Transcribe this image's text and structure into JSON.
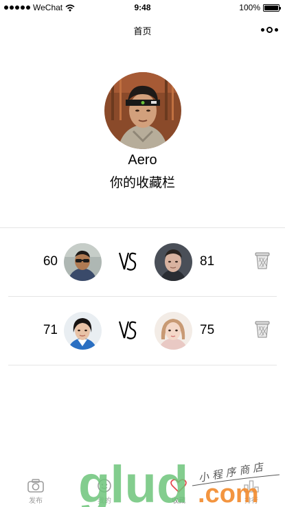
{
  "status_bar": {
    "carrier": "WeChat",
    "time": "9:48",
    "battery": "100%",
    "battery_level": 1.0
  },
  "nav": {
    "title": "首页",
    "more_icon": "more-dots-icon"
  },
  "profile": {
    "name": "Aero",
    "subtitle": "你的收藏栏"
  },
  "comparisons": [
    {
      "left_score": "60",
      "right_score": "81",
      "vs": "VS",
      "delete_icon": "trash-icon"
    },
    {
      "left_score": "71",
      "right_score": "75",
      "vs": "VS",
      "delete_icon": "trash-icon"
    }
  ],
  "tabs": [
    {
      "label": "发布",
      "icon": "camera-icon"
    },
    {
      "label": "我的",
      "icon": "person-icon"
    },
    {
      "label": "收藏",
      "icon": "heart-icon"
    },
    {
      "label": "排行",
      "icon": "rank-icon"
    }
  ],
  "watermark": {
    "brand": "glud",
    "domain": ".com",
    "tagline": "小程序商店"
  },
  "colors": {
    "accent_green": "#6dc47a",
    "accent_teal": "#3fb8b0",
    "accent_orange": "#f28a2b",
    "tab_gray": "#9c9c9c"
  }
}
